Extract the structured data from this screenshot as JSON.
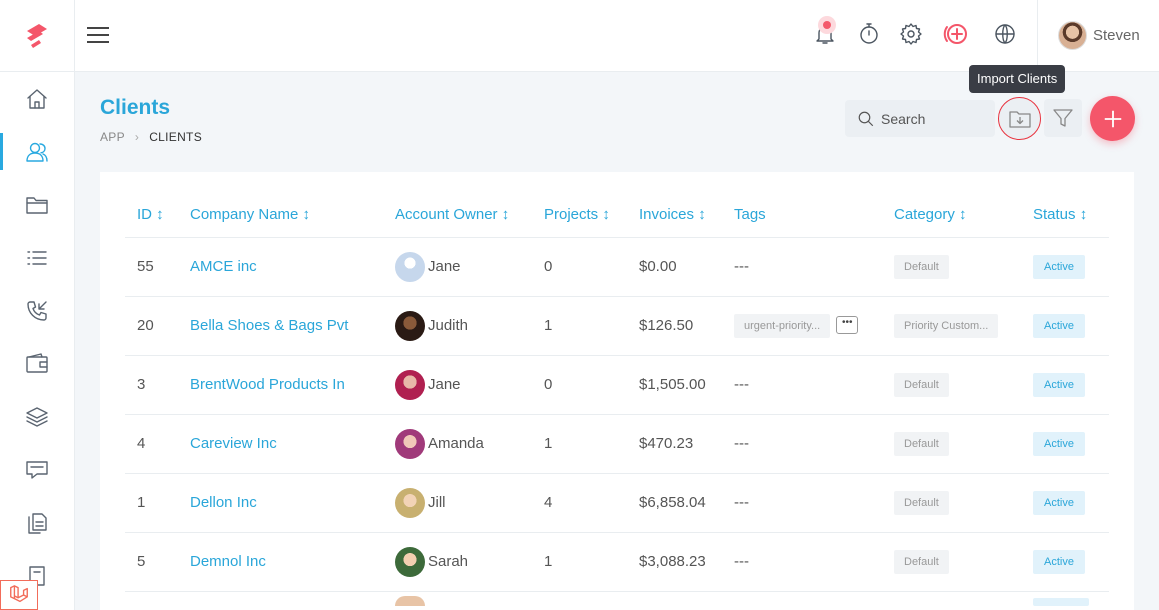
{
  "user": {
    "name": "Steven"
  },
  "tooltip": "Import Clients",
  "page": {
    "title": "Clients",
    "breadcrumb": [
      "APP",
      "CLIENTS"
    ]
  },
  "search": {
    "placeholder": "Search"
  },
  "table": {
    "columns": [
      "ID ↕",
      "Company Name ↕",
      "Account Owner ↕",
      "Projects ↕",
      "Invoices ↕",
      "Tags",
      "Category ↕",
      "Status ↕"
    ],
    "rows": [
      {
        "id": "55",
        "company": "AMCE inc",
        "owner": "Jane",
        "projects": "0",
        "invoices": "$0.00",
        "tags": "---",
        "tag_more": "",
        "category": "Default",
        "status": "Active"
      },
      {
        "id": "20",
        "company": "Bella Shoes & Bags Pvt",
        "owner": "Judith",
        "projects": "1",
        "invoices": "$126.50",
        "tags": "urgent-priority...",
        "tag_more": "•••",
        "category": "Priority Custom...",
        "status": "Active"
      },
      {
        "id": "3",
        "company": "BrentWood Products In",
        "owner": "Jane",
        "projects": "0",
        "invoices": "$1,505.00",
        "tags": "---",
        "tag_more": "",
        "category": "Default",
        "status": "Active"
      },
      {
        "id": "4",
        "company": "Careview Inc",
        "owner": "Amanda",
        "projects": "1",
        "invoices": "$470.23",
        "tags": "---",
        "tag_more": "",
        "category": "Default",
        "status": "Active"
      },
      {
        "id": "1",
        "company": "Dellon Inc",
        "owner": "Jill",
        "projects": "4",
        "invoices": "$6,858.04",
        "tags": "---",
        "tag_more": "",
        "category": "Default",
        "status": "Active"
      },
      {
        "id": "5",
        "company": "Demnol Inc",
        "owner": "Sarah",
        "projects": "1",
        "invoices": "$3,088.23",
        "tags": "---",
        "tag_more": "",
        "category": "Default",
        "status": "Active"
      }
    ]
  },
  "icons": {
    "sidebar": [
      "home-icon",
      "clients-icon",
      "folder-icon",
      "list-icon",
      "phone-icon",
      "wallet-icon",
      "layers-icon",
      "chat-icon",
      "documents-icon",
      "file-icon"
    ],
    "topbar": [
      "bell-icon",
      "timer-icon",
      "settings-icon",
      "add-circle-icon",
      "globe-icon"
    ]
  },
  "colors": {
    "accent": "#2aa6d9",
    "brand_red": "#f4566a",
    "status_bg": "#e1f2fb"
  }
}
